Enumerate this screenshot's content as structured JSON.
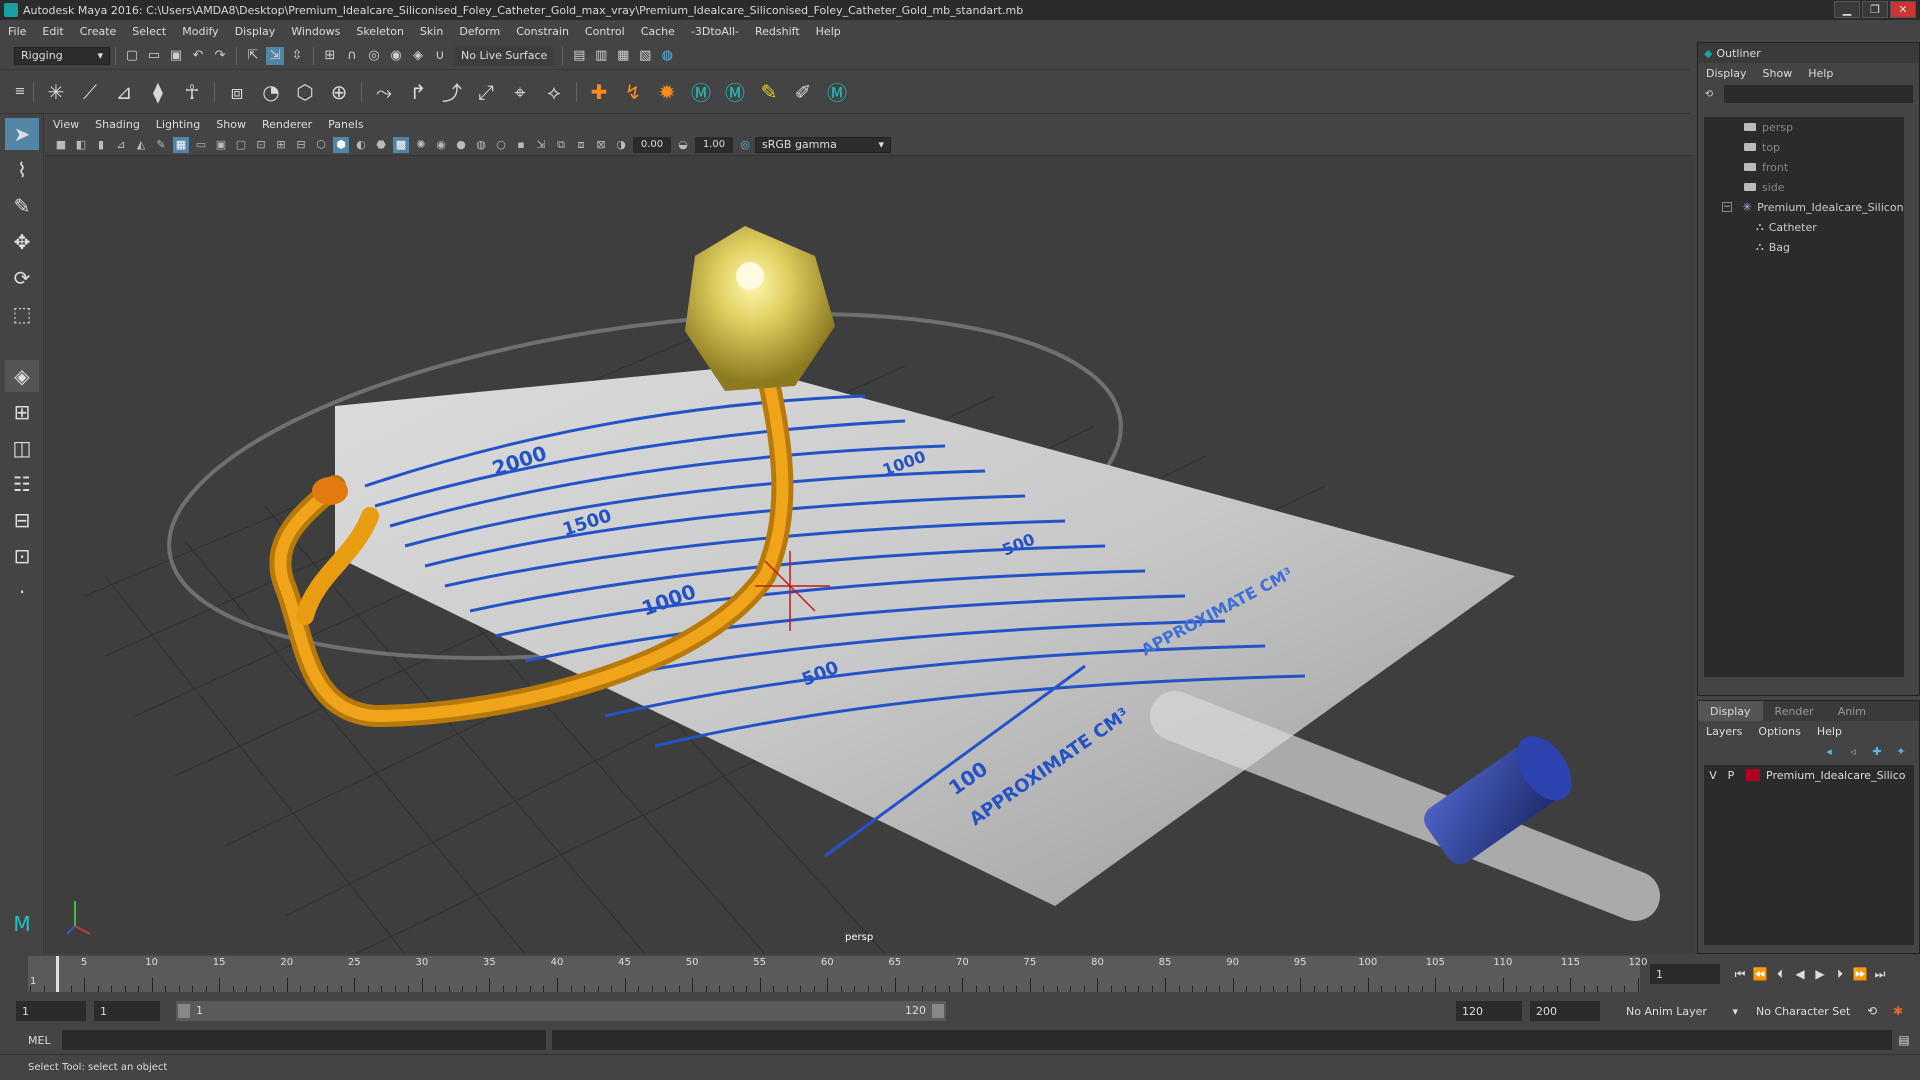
{
  "window": {
    "title": "Autodesk Maya 2016: C:\\Users\\AMDA8\\Desktop\\Premium_Idealcare_Siliconised_Foley_Catheter_Gold_max_vray\\Premium_Idealcare_Siliconised_Foley_Catheter_Gold_mb_standart.mb",
    "minimize": "▁",
    "maximize": "❐",
    "close": "✕"
  },
  "menubar": [
    "File",
    "Edit",
    "Create",
    "Select",
    "Modify",
    "Display",
    "Windows",
    "Skeleton",
    "Skin",
    "Deform",
    "Constrain",
    "Control",
    "Cache",
    "-3DtoAll-",
    "Redshift",
    "Help"
  ],
  "statusline": {
    "mode": "Rigging",
    "live_surface": "No Live Surface"
  },
  "viewport": {
    "menu": [
      "View",
      "Shading",
      "Lighting",
      "Show",
      "Renderer",
      "Panels"
    ],
    "exposure": "0.00",
    "gamma": "1.00",
    "color_space": "sRGB gamma",
    "camera_label": "persp",
    "bag_labels": [
      "2000",
      "1500",
      "1000",
      "1000",
      "500",
      "500",
      "100"
    ],
    "bag_text_1": "APPROXIMATE CM³",
    "bag_text_2": "APPROXIMATE CM³"
  },
  "outliner": {
    "title": "Outliner",
    "menu": [
      "Display",
      "Show",
      "Help"
    ],
    "items": [
      {
        "label": "persp",
        "type": "camera"
      },
      {
        "label": "top",
        "type": "camera"
      },
      {
        "label": "front",
        "type": "camera"
      },
      {
        "label": "side",
        "type": "camera"
      },
      {
        "label": "Premium_Idealcare_Silicon",
        "type": "group"
      },
      {
        "label": "Catheter",
        "type": "mesh"
      },
      {
        "label": "Bag",
        "type": "mesh"
      }
    ],
    "expand_symbol": "−"
  },
  "layers": {
    "tabs": [
      "Display",
      "Render",
      "Anim"
    ],
    "menu": [
      "Layers",
      "Options",
      "Help"
    ],
    "rows": [
      {
        "v": "V",
        "p": "P",
        "name": "Premium_Idealcare_Silico",
        "color": "#b00020"
      }
    ]
  },
  "timeline": {
    "ticks": [
      5,
      10,
      15,
      20,
      25,
      30,
      35,
      40,
      45,
      50,
      55,
      60,
      65,
      70,
      75,
      80,
      85,
      90,
      95,
      100,
      105,
      110,
      115,
      120
    ],
    "first_frame": "1",
    "current_frame": "1",
    "min": 1,
    "max": 120
  },
  "range": {
    "start": "1",
    "playback_start": "1",
    "range_start_label": "1",
    "range_end_label": "120",
    "playback_end": "120",
    "end": "200",
    "anim_layer": "No Anim Layer",
    "character_set": "No Character Set"
  },
  "cmdline": {
    "label": "MEL"
  },
  "helpline": {
    "text": "Select Tool: select an object"
  }
}
